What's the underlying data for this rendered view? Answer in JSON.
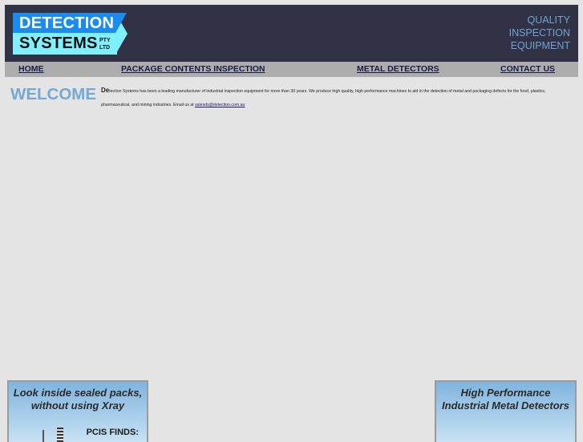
{
  "header": {
    "logo": {
      "line1": "DETECTION",
      "line2": "SYSTEMS",
      "suffix_line1": "PTY",
      "suffix_line2": "LTD"
    },
    "tagline": [
      "QUALITY",
      "INSPECTION",
      "EQUIPMENT"
    ]
  },
  "nav": {
    "items": [
      {
        "label": "HOME"
      },
      {
        "label": "PACKAGE CONTENTS INSPECTION"
      },
      {
        "label": "METAL DETECTORS"
      },
      {
        "label": "CONTACT US"
      }
    ]
  },
  "main": {
    "heading": "WELCOME",
    "intro_cap": "De",
    "intro_text": "tection Systems has been a leading manufacturer of industrial inspection equipment for more than 30 years. We produce high quality, high performance machines to aid in the detection of metal and packaging defects for the food, plastics, pharmaceutical, and mining industries. Email us at ",
    "email": "salesds@detection.com.au"
  },
  "banners": {
    "left": {
      "title_line1": "Look inside sealed packs,",
      "title_line2": "without using Xray",
      "subtitle": "PCIS FINDS:"
    },
    "right": {
      "title_line1": "High Performance",
      "title_line2": "Industrial Metal Detectors"
    }
  },
  "colors": {
    "header_bg": "#323247",
    "nav_bg": "#adadad",
    "page_bg": "#e4e4e4",
    "logo_blue": "#1a8cf0",
    "logo_cyan": "#7ff0fc",
    "welcome": "#74a9d3",
    "tagline": "#6fa3d2"
  }
}
